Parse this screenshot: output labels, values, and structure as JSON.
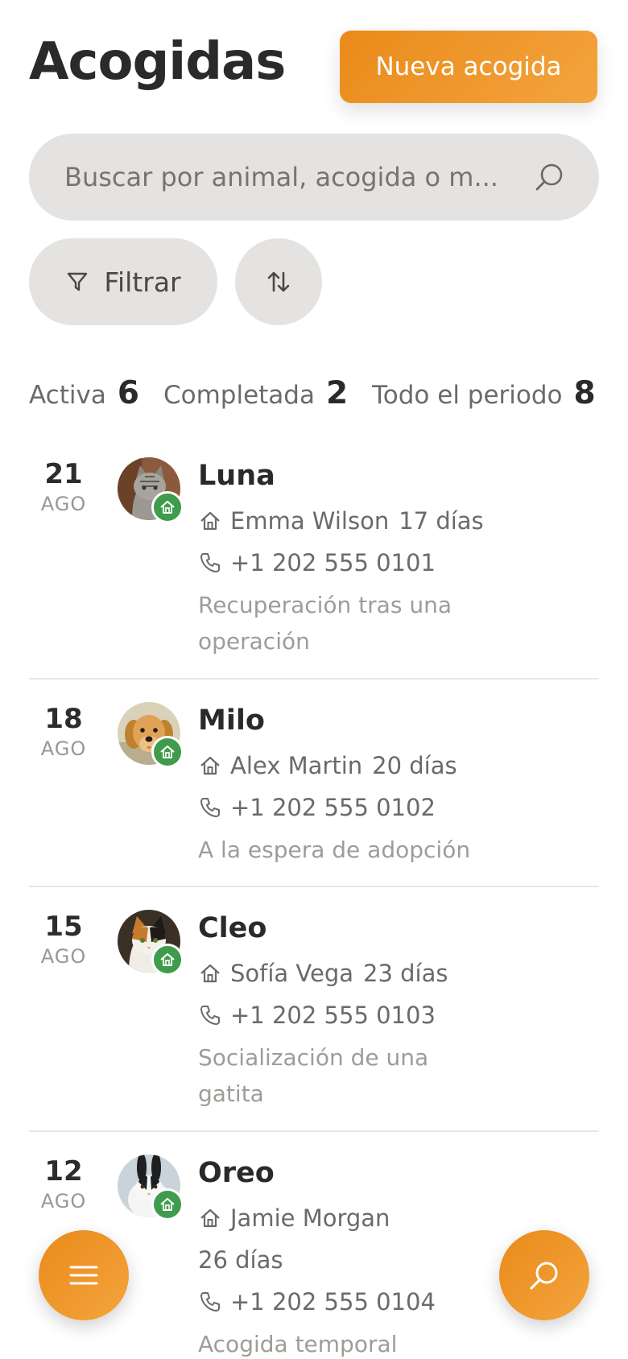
{
  "header": {
    "title": "Acogidas",
    "new_button_label": "Nueva acogida"
  },
  "search": {
    "placeholder": "Buscar por animal, acogida o m..."
  },
  "controls": {
    "filter_label": "Filtrar",
    "sort_icon": "sort-icon"
  },
  "stats": [
    {
      "label": "Activa",
      "value": "6"
    },
    {
      "label": "Completada",
      "value": "2"
    },
    {
      "label": "Todo el periodo",
      "value": "8"
    }
  ],
  "fosters": [
    {
      "day": "21",
      "month": "AGO",
      "animal": "Luna",
      "caregiver": "Emma Wilson",
      "duration": "17 días",
      "phone": "+1 202 555 0101",
      "note": "Recuperación tras una operación",
      "avatar": "cat-grey-tabby"
    },
    {
      "day": "18",
      "month": "AGO",
      "animal": "Milo",
      "caregiver": "Alex Martin",
      "duration": "20 días",
      "phone": "+1 202 555 0102",
      "note": "A la espera de adopción",
      "avatar": "golden-retriever"
    },
    {
      "day": "15",
      "month": "AGO",
      "animal": "Cleo",
      "caregiver": "Sofía Vega",
      "duration": "23 días",
      "phone": "+1 202 555 0103",
      "note": "Socialización de una gatita",
      "avatar": "calico-cat"
    },
    {
      "day": "12",
      "month": "AGO",
      "animal": "Oreo",
      "caregiver": "Jamie Morgan",
      "duration": "26 días",
      "phone": "+1 202 555 0104",
      "note": "Acogida temporal",
      "avatar": "black-white-rabbit"
    }
  ],
  "colors": {
    "accent": "#ee911f",
    "badge_green": "#3f9c4c",
    "pill_bg": "#e4e3e1"
  },
  "fab": {
    "menu_icon": "menu-icon",
    "search_icon": "search-icon"
  }
}
